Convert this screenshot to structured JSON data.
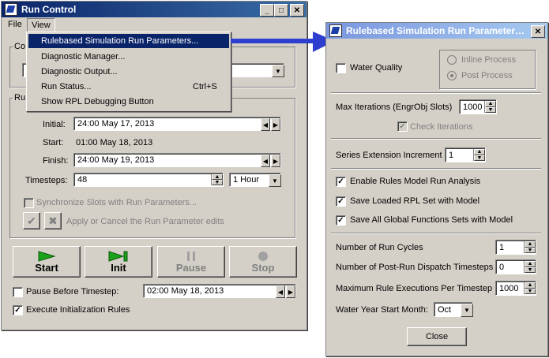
{
  "run_control": {
    "title": "Run Control",
    "menubar": {
      "file": "File",
      "view": "View"
    },
    "view_menu": {
      "items": [
        {
          "label": "Rulebased Simulation Run Parameters...",
          "shortcut": ""
        },
        {
          "label": "Diagnostic Manager...",
          "shortcut": ""
        },
        {
          "label": "Diagnostic Output...",
          "shortcut": ""
        },
        {
          "label": "Run Status...",
          "shortcut": "Ctrl+S"
        },
        {
          "label": "Show RPL Debugging Button",
          "shortcut": ""
        }
      ]
    },
    "group1_label": "Co",
    "group2_label": "Ru",
    "initial_label": "Initial:",
    "initial_value": "24:00 May 17, 2013",
    "start_label": "Start:",
    "start_value": "01:00 May 18, 2013",
    "finish_label": "Finish:",
    "finish_value": "24:00 May 19, 2013",
    "timesteps_label": "Timesteps:",
    "timesteps_value": "48",
    "timestep_unit": "1 Hour",
    "sync_label": "Synchronize Slots with Run Parameters...",
    "apply_label": "Apply or Cancel the Run Parameter edits",
    "buttons": {
      "start": "Start",
      "init": "Init",
      "pause": "Pause",
      "stop": "Stop"
    },
    "pause_before_label": "Pause Before Timestep:",
    "pause_before_value": "02:00 May 18, 2013",
    "exec_init_label": "Execute Initialization Rules"
  },
  "rb_params": {
    "title": "Rulebased Simulation Run Parameters...",
    "water_quality": "Water Quality",
    "inline_process": "Inline Process",
    "post_process": "Post Process",
    "max_iter_label": "Max Iterations  (EngrObj Slots)",
    "max_iter_value": "1000",
    "check_iter_label": "Check Iterations",
    "series_ext_label": "Series Extension Increment",
    "series_ext_value": "1",
    "enable_rules_label": "Enable Rules Model Run Analysis",
    "save_rpl_label": "Save Loaded RPL Set with Model",
    "save_global_label": "Save All Global Functions Sets with Model",
    "run_cycles_label": "Number of Run Cycles",
    "run_cycles_value": "1",
    "post_run_label": "Number of Post-Run Dispatch Timesteps",
    "post_run_value": "0",
    "max_rule_label": "Maximum Rule Executions Per Timestep",
    "max_rule_value": "1000",
    "water_year_label": "Water Year Start Month:",
    "water_year_value": "Oct",
    "close_label": "Close"
  },
  "colors": {
    "arrow": "#2e3fd0",
    "title_active": "#0a246a",
    "title_inactive": "#7a96df",
    "menu_highlight": "#0a246a",
    "start_green": "#1aa31a"
  }
}
